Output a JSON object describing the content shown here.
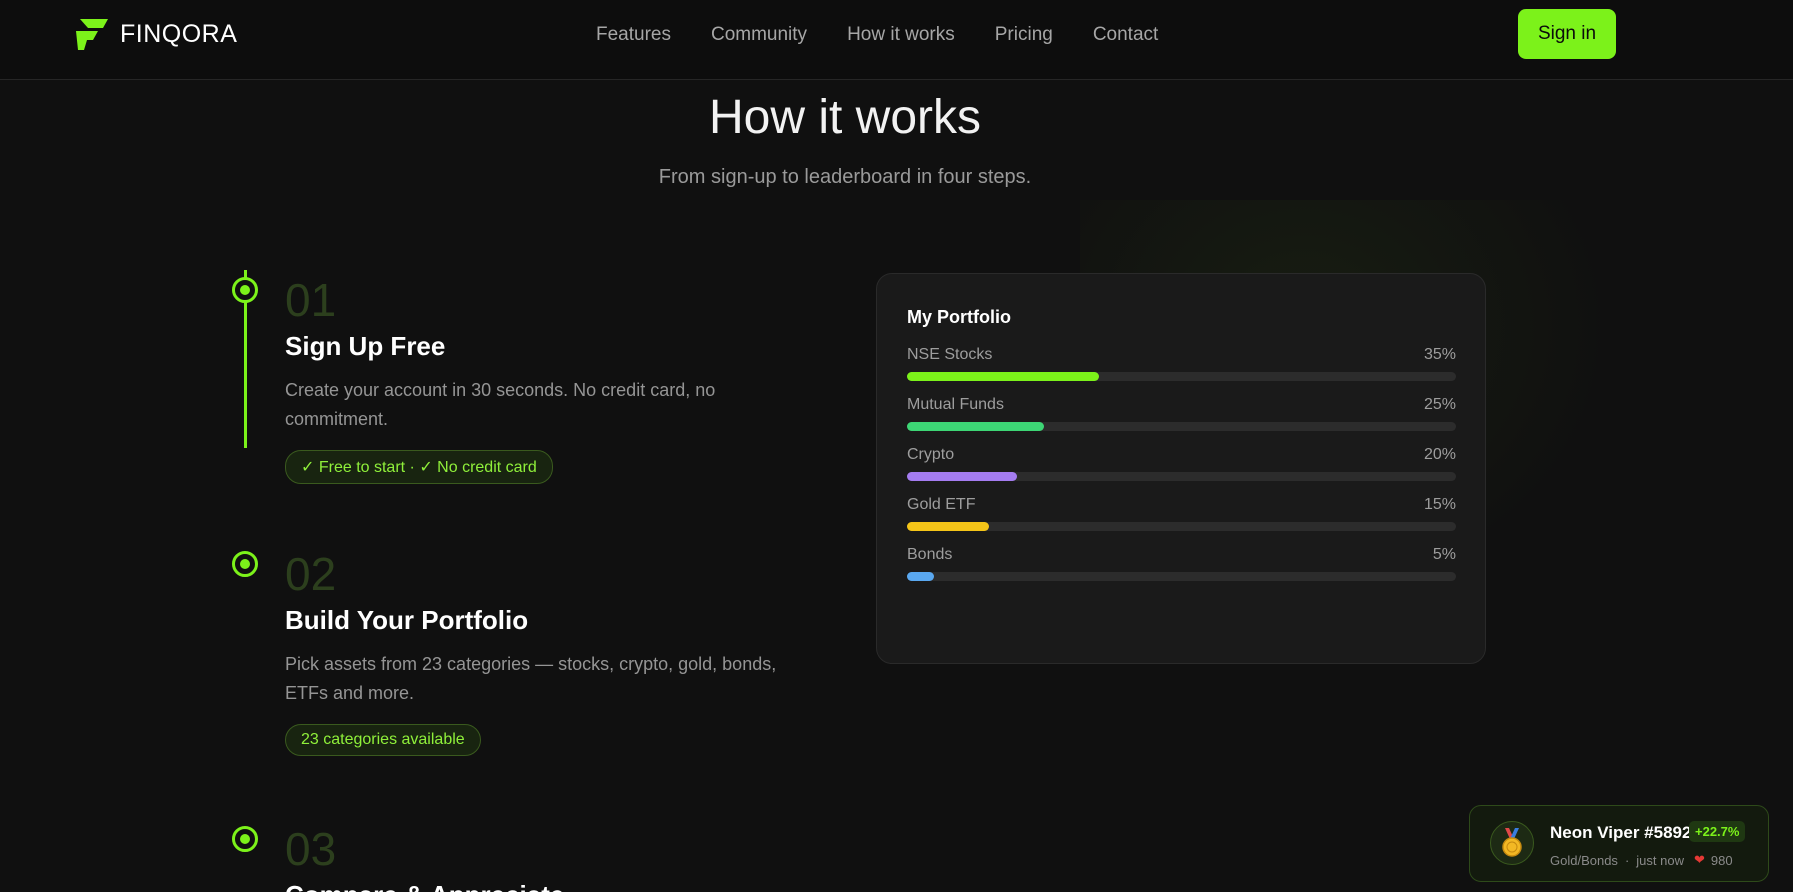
{
  "nav": {
    "logo_text": "FINQORA",
    "links": [
      "Features",
      "Community",
      "How it works",
      "Pricing",
      "Contact"
    ],
    "signin_label": "Sign in"
  },
  "section": {
    "title": "How it works",
    "subtitle": "From sign-up to leaderboard in four steps."
  },
  "steps": [
    {
      "num": "01",
      "title": "Sign Up Free",
      "desc": "Create your account in 30 seconds. No credit card, no commitment.",
      "badge": "✓ Free to start · ✓ No credit card"
    },
    {
      "num": "02",
      "title": "Build Your Portfolio",
      "desc": "Pick assets from 23 categories — stocks, crypto, gold, bonds, ETFs and more.",
      "badge": "23 categories available"
    },
    {
      "num": "03",
      "title": "Compare & Appreciate"
    }
  ],
  "portfolio": {
    "title": "My Portfolio",
    "allocations": [
      {
        "label": "NSE Stocks",
        "pct_label": "35%",
        "pct": 35,
        "color": "#7cf21a"
      },
      {
        "label": "Mutual Funds",
        "pct_label": "25%",
        "pct": 25,
        "color": "#3dd675"
      },
      {
        "label": "Crypto",
        "pct_label": "20%",
        "pct": 20,
        "color": "#a47cf0"
      },
      {
        "label": "Gold ETF",
        "pct_label": "15%",
        "pct": 15,
        "color": "#f5c518"
      },
      {
        "label": "Bonds",
        "pct_label": "5%",
        "pct": 5,
        "color": "#5aa8f0"
      }
    ]
  },
  "toast": {
    "name": "Neon Viper #5892",
    "change": "+22.7%",
    "category": "Gold/Bonds",
    "time": "just now",
    "likes": "980",
    "icon": "medal-icon"
  }
}
